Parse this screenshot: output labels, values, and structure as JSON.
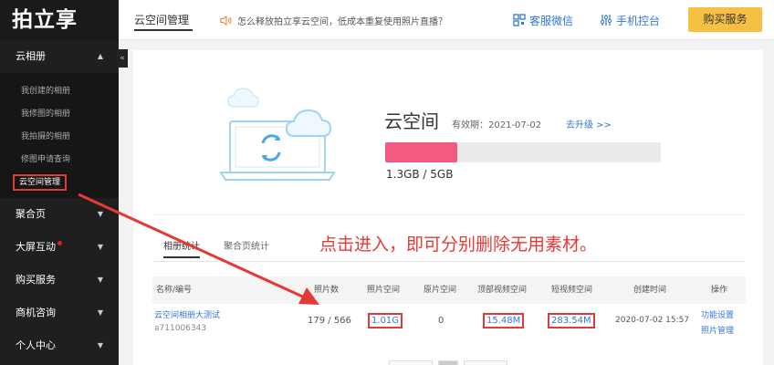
{
  "logo": "拍立享",
  "header": {
    "page_tab": "云空间管理",
    "notice": "怎么释放拍立享云空间，低成本重复使用照片直播？",
    "service": "客服微信",
    "console": "手机控台",
    "buy": "购买服务"
  },
  "sidebar": {
    "collapse": "«",
    "groups": [
      {
        "label": "云相册",
        "arrow": "▲"
      },
      {
        "label": "聚合页",
        "arrow": "▼"
      },
      {
        "label": "大屏互动",
        "arrow": "▼"
      },
      {
        "label": "购买服务",
        "arrow": "▼"
      },
      {
        "label": "商机咨询",
        "arrow": "▼"
      },
      {
        "label": "个人中心",
        "arrow": "▼"
      }
    ],
    "subitems": [
      "我创建的相册",
      "我修图的相册",
      "我拍摄的相册",
      "修图申请查询",
      "云空间管理"
    ]
  },
  "space": {
    "title": "云空间",
    "valid": "有效期：2021-07-02",
    "upgrade": "去升级 >>",
    "usage": "1.3GB / 5GB",
    "usage_percent": 26
  },
  "annotation": "点击进入，即可分别删除无用素材。",
  "tabs": [
    "相册统计",
    "聚合页统计"
  ],
  "table": {
    "headers": [
      "名称/编号",
      "照片数",
      "照片空间",
      "原片空间",
      "顶部视频空间",
      "短视频空间",
      "创建时间",
      "操作"
    ],
    "row": {
      "name": "云空间相册大测试",
      "id": "a711006343",
      "photos": "179 / 566",
      "photo_space": "1.01G",
      "raw_space": "0",
      "top_video": "15.48M",
      "short_video": "283.54M",
      "created": "2020-07-02 15:57",
      "action1": "功能设置",
      "action2": "照片管理"
    }
  },
  "colors": {
    "accent": "#3478d6",
    "annotation": "#e53935",
    "progress": "#f25a82",
    "buy": "#f6c044"
  }
}
